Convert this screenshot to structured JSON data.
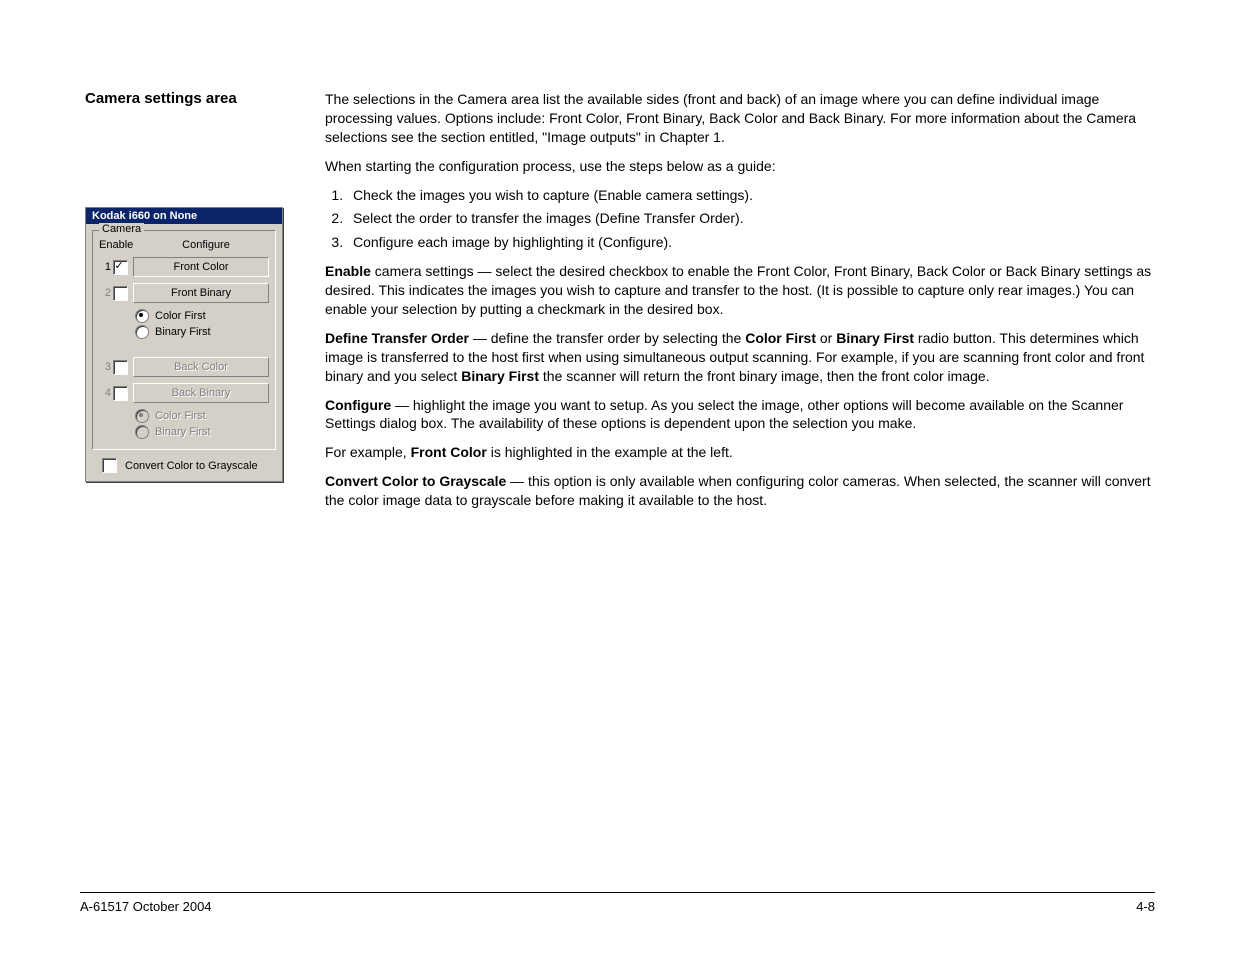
{
  "heading": "Camera settings area",
  "intro": "The selections in the Camera area list the available sides (front and back) of an image where you can define individual image processing values. Options include: Front Color, Front Binary, Back Color and Back Binary. For more information about the Camera selections see the section entitled, \"Image outputs\" in Chapter 1.",
  "guide_intro": "When starting the configuration process, use the steps below as a guide:",
  "steps": [
    "Check the images you wish to capture (Enable camera settings).",
    "Select the order to transfer the images (Define Transfer Order).",
    "Configure each image by highlighting it (Configure)."
  ],
  "para_enable_bold": "Enable",
  "para_enable_mid": " camera settings ",
  "para_enable_rest": " select the desired checkbox to enable the Front Color, Front Binary, Back Color or Back Binary settings as desired. This indicates the images you wish to capture and transfer to the host. (It is possible to capture only rear images.) You can enable your selection by putting a checkmark in the desired box.",
  "para_dto_bold": "Define Transfer Order",
  "para_dto_rest_a": " define the transfer order by selecting the ",
  "para_dto_cf": "Color First",
  "para_dto_or": " or ",
  "para_dto_bf": "Binary First",
  "para_dto_rest_b": " radio button. This determines which image is transferred to the host first when using simultaneous output scanning. For example, if you are scanning front color and front binary and you select ",
  "para_dto_bf2": "Binary First",
  "para_dto_rest_c": " the scanner will return the front binary image, then the front color image.",
  "para_config_bold": "Configure",
  "para_config_rest": " highlight the image you want to setup. As you select the image, other options will become available on the Scanner Settings dialog box. The availability of these options is dependent upon the selection you make.",
  "para_example_a": "For example, ",
  "para_example_bold": "Front Color",
  "para_example_b": " is highlighted in the example at the left.",
  "para_gray_bold": "Convert Color to Grayscale",
  "para_gray_rest": " this option is only available when configuring color cameras. When selected, the scanner will convert the color image data to grayscale before making it available to the host.",
  "dialog": {
    "title": "Kodak i660 on None",
    "legend": "Camera",
    "hdr_enable": "Enable",
    "hdr_config": "Configure",
    "rows": [
      {
        "num": "1",
        "label": "Front Color"
      },
      {
        "num": "2",
        "label": "Front Binary"
      },
      {
        "num": "3",
        "label": "Back Color"
      },
      {
        "num": "4",
        "label": "Back Binary"
      }
    ],
    "radio_color": "Color First",
    "radio_binary": "Binary First",
    "grayscale": "Convert Color to Grayscale"
  },
  "footer_left": "A-61517 October 2004",
  "footer_right": "4-8",
  "em_dash": "—"
}
